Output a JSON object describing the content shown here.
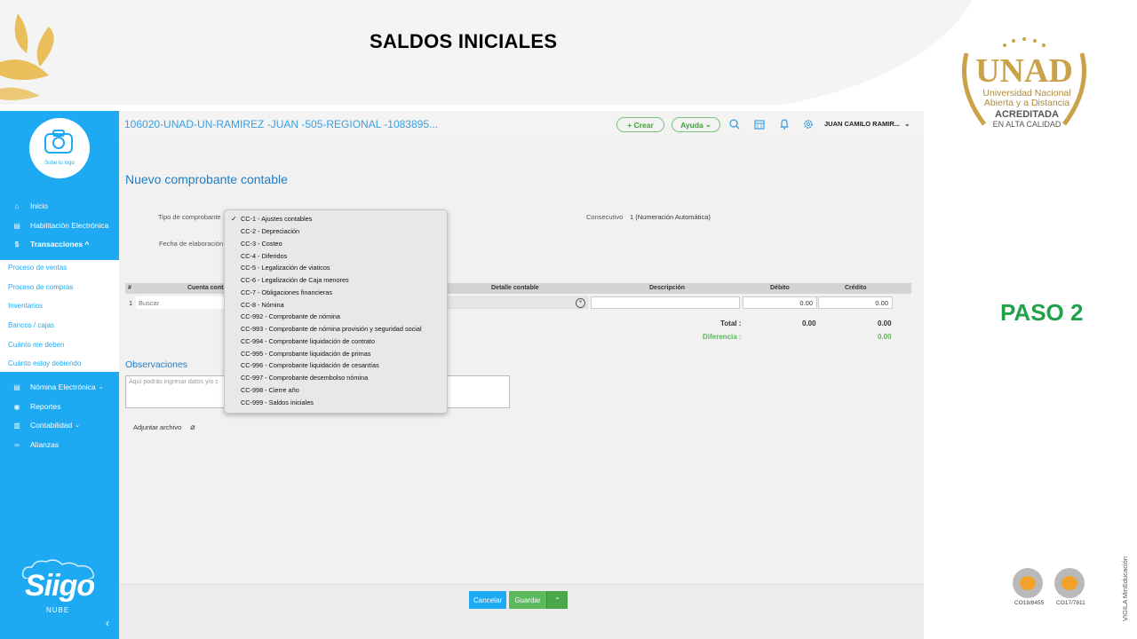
{
  "slide": {
    "title": "SALDOS INICIALES",
    "step": "PASO 2"
  },
  "unad_logo": {
    "mark": "UNAD",
    "name_line1": "Universidad Nacional",
    "name_line2": "Abierta y a Distancia",
    "accredited": "ACREDITADA",
    "quality": "EN ALTA CALIDAD"
  },
  "certifications": [
    {
      "code": "CO18/8455"
    },
    {
      "code": "CO17/7811"
    }
  ],
  "footer_vertical": "VIGILA MinEducación",
  "app": {
    "company_title": "106020-UNAD-UN-RAMIREZ -JUAN -505-REGIONAL -1083895...",
    "create_button": "+ Crear",
    "help_button": "Ayuda",
    "user_name": "JUAN CAMILO RAMIR...",
    "logo_placeholder": "Sube tu logo",
    "brand": "Siigo",
    "brand_sub": "NUBE"
  },
  "sidebar": {
    "items": [
      {
        "label": "Inicio",
        "icon": "home-icon"
      },
      {
        "label": "Habilitación Electrónica",
        "icon": "document-icon"
      },
      {
        "label": "Transacciones ^",
        "icon": "transactions-icon"
      }
    ],
    "submenu": [
      "Proceso de ventas",
      "Proceso de compras",
      "Inventarios",
      "Bancos / cajas",
      "Cuánto me deben",
      "Cuánto estoy debiendo"
    ],
    "lower_items": [
      {
        "label": "Nómina Electrónica",
        "icon": "payroll-icon"
      },
      {
        "label": "Reportes",
        "icon": "reports-icon"
      },
      {
        "label": "Contabilidad",
        "icon": "accounting-icon"
      },
      {
        "label": "Alianzas",
        "icon": "link-icon"
      }
    ]
  },
  "form": {
    "heading": "Nuevo comprobante contable",
    "type_label": "Tipo de comprobante",
    "date_label": "Fecha de elaboración",
    "consecutive_label": "Consecutivo",
    "consecutive_value": "1 (Numeración Automática)",
    "table_headers": [
      "#",
      "Cuenta conta",
      "Detalle contable",
      "Descripción",
      "Débito",
      "Crédito"
    ],
    "row_number": "1",
    "search_placeholder": "Buscar",
    "debit_value": "0.00",
    "credit_value": "0.00",
    "total_label": "Total :",
    "total_debit": "0.00",
    "total_credit": "0.00",
    "difference_label": "Diferencia :",
    "difference_value": "0.00",
    "observations_label": "Observaciones",
    "observations_placeholder": "Aquí podrás ingresar datos y/o c",
    "attach_label": "Adjuntar archivo"
  },
  "dropdown": {
    "selected_index": 20,
    "checked_index": 0,
    "options": [
      "CC-1 - Ajustes contables",
      "CC-2 - Depreciación",
      "CC-3 - Costeo",
      "CC-4 - Diferidos",
      "CC-5 - Legalización de viaticos",
      "CC-6 - Legalización de Caja menores",
      "CC-7 - Obligaciones financieras",
      "CC-8 - Nómina",
      "CC-992 - Comprobante de nómina",
      "CC-993 - Comprobante de nómina provisión y seguridad social",
      "CC-994 - Comprobante liquidación de contrato",
      "CC-995 - Comprobante liquidación de primas",
      "CC-996 - Comprobante liquidación de cesantías",
      "CC-997 - Comprobante desembolso nómina",
      "CC-998 - Cierre año",
      "CC-999 - Saldos iniciales"
    ]
  },
  "actions": {
    "cancel": "Cancelar",
    "save": "Guardar"
  },
  "colors": {
    "sidebar": "#1ea9f3",
    "step_green": "#1fa24a",
    "selected_option": "#5b9ef6",
    "save_green": "#5cb85c",
    "cancel_blue": "#1ea9f3"
  }
}
